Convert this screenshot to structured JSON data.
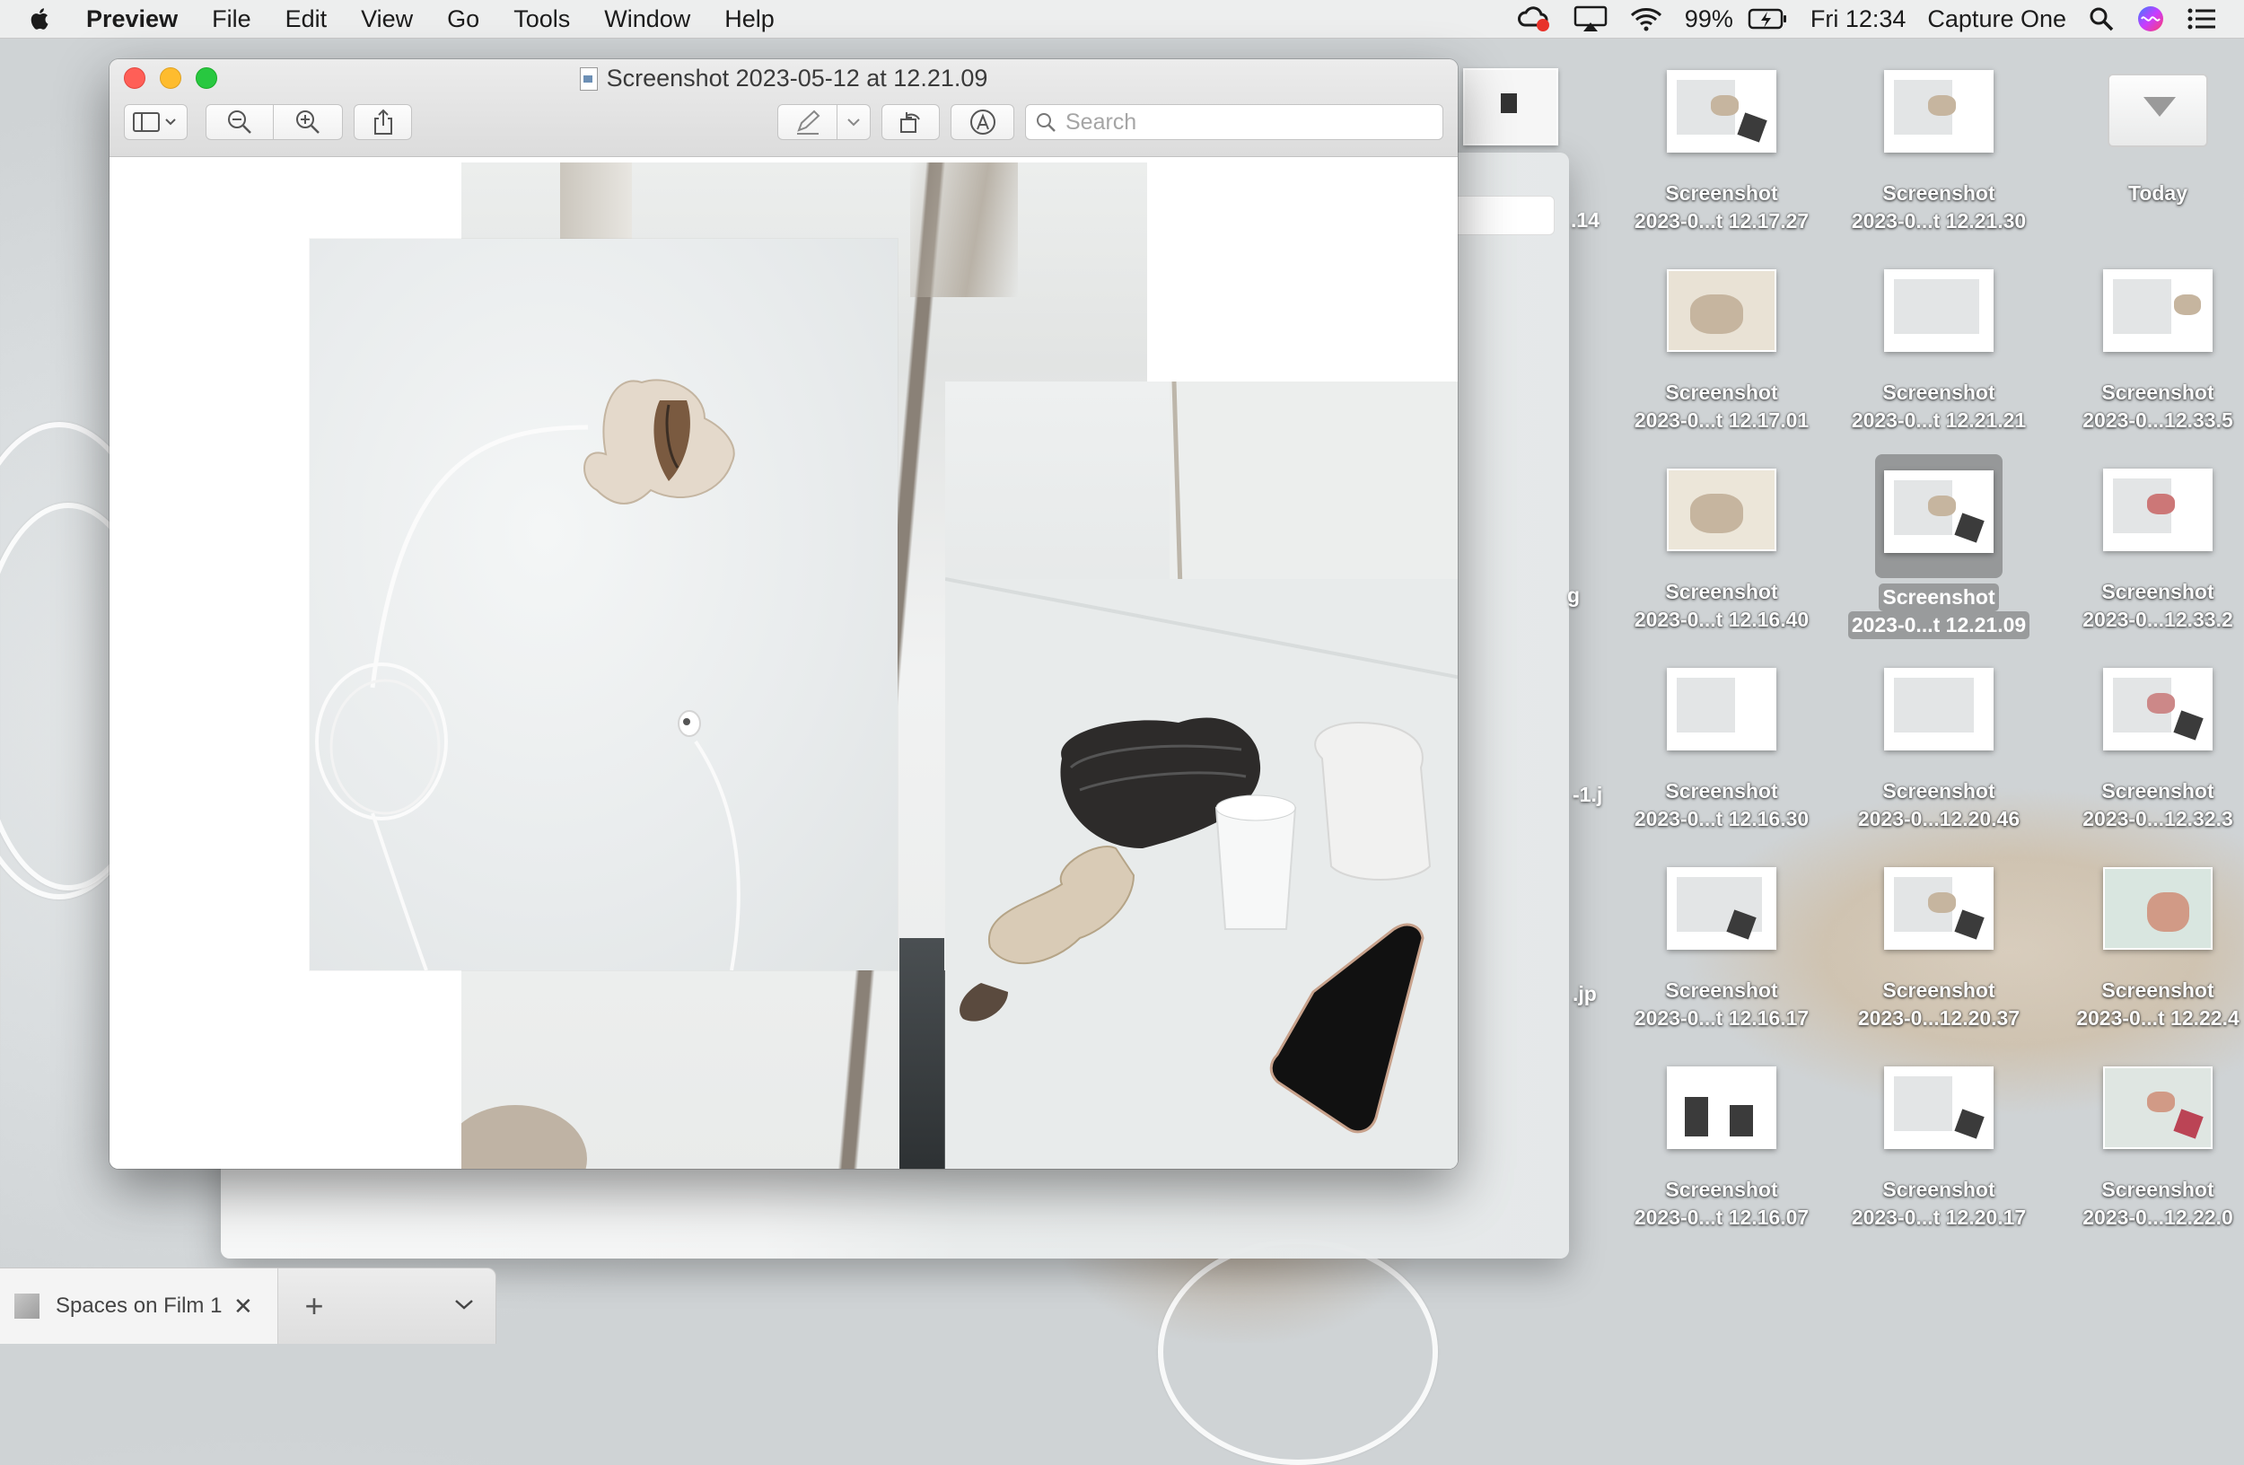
{
  "menubar": {
    "app_name": "Preview",
    "menus": [
      "File",
      "Edit",
      "View",
      "Go",
      "Tools",
      "Window",
      "Help"
    ],
    "battery": "99%",
    "clock": "Fri 12:34",
    "active_app": "Capture One"
  },
  "window": {
    "title": "Screenshot 2023-05-12 at 12.21.09",
    "search_placeholder": "Search"
  },
  "desktop": {
    "icons": [
      {
        "line1": "Screenshot",
        "line2": "2023-0...t 12.17.27"
      },
      {
        "line1": "Screenshot",
        "line2": "2023-0...t 12.21.30"
      },
      {
        "line1": "Today",
        "line2": ""
      },
      {
        "line1": "Screenshot",
        "line2": "2023-0...t 12.17.01"
      },
      {
        "line1": "Screenshot",
        "line2": "2023-0...t 12.21.21"
      },
      {
        "line1": "Screenshot",
        "line2": "2023-0...12.33.5"
      },
      {
        "line1": "Screenshot",
        "line2": "2023-0...t 12.16.40"
      },
      {
        "line1": "Screenshot",
        "line2": "2023-0...t 12.21.09"
      },
      {
        "line1": "Screenshot",
        "line2": "2023-0...12.33.2"
      },
      {
        "line1": "Screenshot",
        "line2": "2023-0...t 12.16.30"
      },
      {
        "line1": "Screenshot",
        "line2": "2023-0...12.20.46"
      },
      {
        "line1": "Screenshot",
        "line2": "2023-0...12.32.3"
      },
      {
        "line1": "Screenshot",
        "line2": "2023-0...t 12.16.17"
      },
      {
        "line1": "Screenshot",
        "line2": "2023-0...12.20.37"
      },
      {
        "line1": "Screenshot",
        "line2": "2023-0...t 12.22.4"
      },
      {
        "line1": "Screenshot",
        "line2": "2023-0...t 12.16.07"
      },
      {
        "line1": "Screenshot",
        "line2": "2023-0...t 12.20.17"
      },
      {
        "line1": "Screenshot",
        "line2": "2023-0...12.22.0"
      }
    ],
    "partial_labels": [
      ".14",
      "g",
      "-1.j",
      ".jp"
    ]
  },
  "tabbar": {
    "tab_label": "Spaces on Film 1",
    "close": "✕",
    "add": "+"
  }
}
